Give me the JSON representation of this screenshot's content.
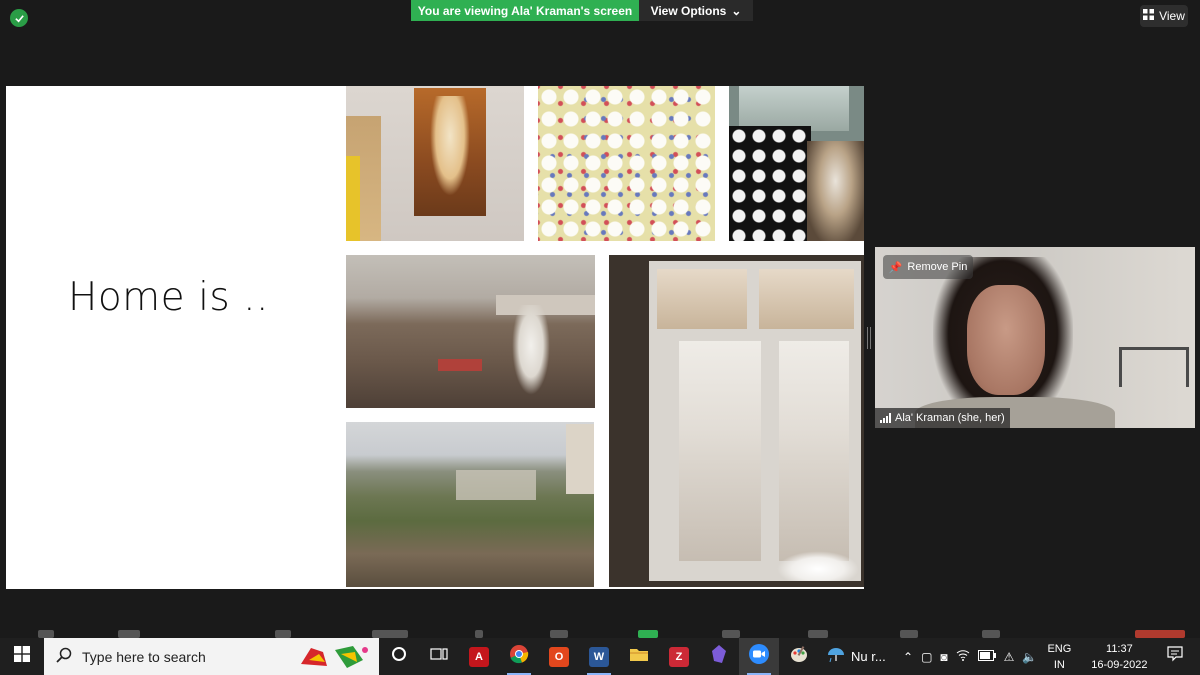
{
  "zoom": {
    "banner_text": "You are viewing Ala' Kraman's screen",
    "view_options_label": "View Options",
    "view_label": "View"
  },
  "slide": {
    "title": "Home is .."
  },
  "participant": {
    "name": "Ala' Kraman (she, her)",
    "remove_pin_label": "Remove Pin"
  },
  "taskbar": {
    "search_placeholder": "Type here to search",
    "weather_text": "Nu r...",
    "language_line1": "ENG",
    "language_line2": "IN",
    "time": "11:37",
    "date": "16-09-2022",
    "apps": [
      "task-view",
      "adobe-acrobat",
      "chrome",
      "office",
      "word",
      "file-explorer",
      "zotero",
      "obsidian",
      "zoom",
      "paint"
    ]
  },
  "colors": {
    "banner_green": "#2fb052",
    "background": "#1a1a1a",
    "taskbar": "#1f1f1f"
  }
}
